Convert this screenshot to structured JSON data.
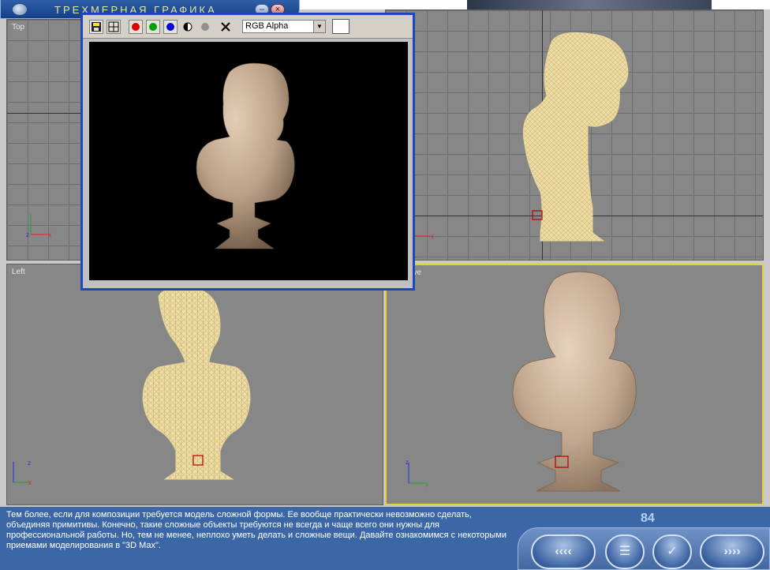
{
  "window": {
    "title": "ТРЕХМЕРНАЯ ГРАФИКА",
    "minimize_glyph": "–",
    "close_glyph": "×"
  },
  "viewports": {
    "top": {
      "label": "Top"
    },
    "front": {
      "label": ""
    },
    "left": {
      "label": "Left"
    },
    "perspective": {
      "label": "ective"
    }
  },
  "render_window": {
    "channel_select": "RGB Alpha",
    "buttons": [
      {
        "name": "save-icon"
      },
      {
        "name": "clone-icon"
      },
      {
        "name": "red-channel",
        "color": "#e00000"
      },
      {
        "name": "green-channel",
        "color": "#00a000"
      },
      {
        "name": "blue-channel",
        "color": "#0000e0"
      },
      {
        "name": "alpha-channel"
      },
      {
        "name": "mono-channel",
        "color": "#909090"
      },
      {
        "name": "clear-icon"
      }
    ]
  },
  "info": {
    "text": "Тем более, если для композиции требуется модель сложной формы. Ее вообще практически невозможно сделать, объединяя примитивы. Конечно, такие сложные объекты требуются не всегда и чаще всего они нужны для профессиональной работы. Но, тем не менее, неплохо уметь делать и сложные вещи. Давайте ознакомимся с некоторыми приемами моделирования в \"3D Max\"."
  },
  "page_number": "84",
  "nav": {
    "back_glyph": "‹‹‹‹",
    "menu_glyph": "☰",
    "check_glyph": "✓",
    "forward_glyph": "››››"
  },
  "colors": {
    "active_viewport": "#e0d23c",
    "render_frame_border": "#1d46b8",
    "wireframe": "#f0e0a8",
    "panel": "#3c67a6"
  },
  "axis_labels": {
    "x": "x",
    "y": "y",
    "z": "z"
  }
}
